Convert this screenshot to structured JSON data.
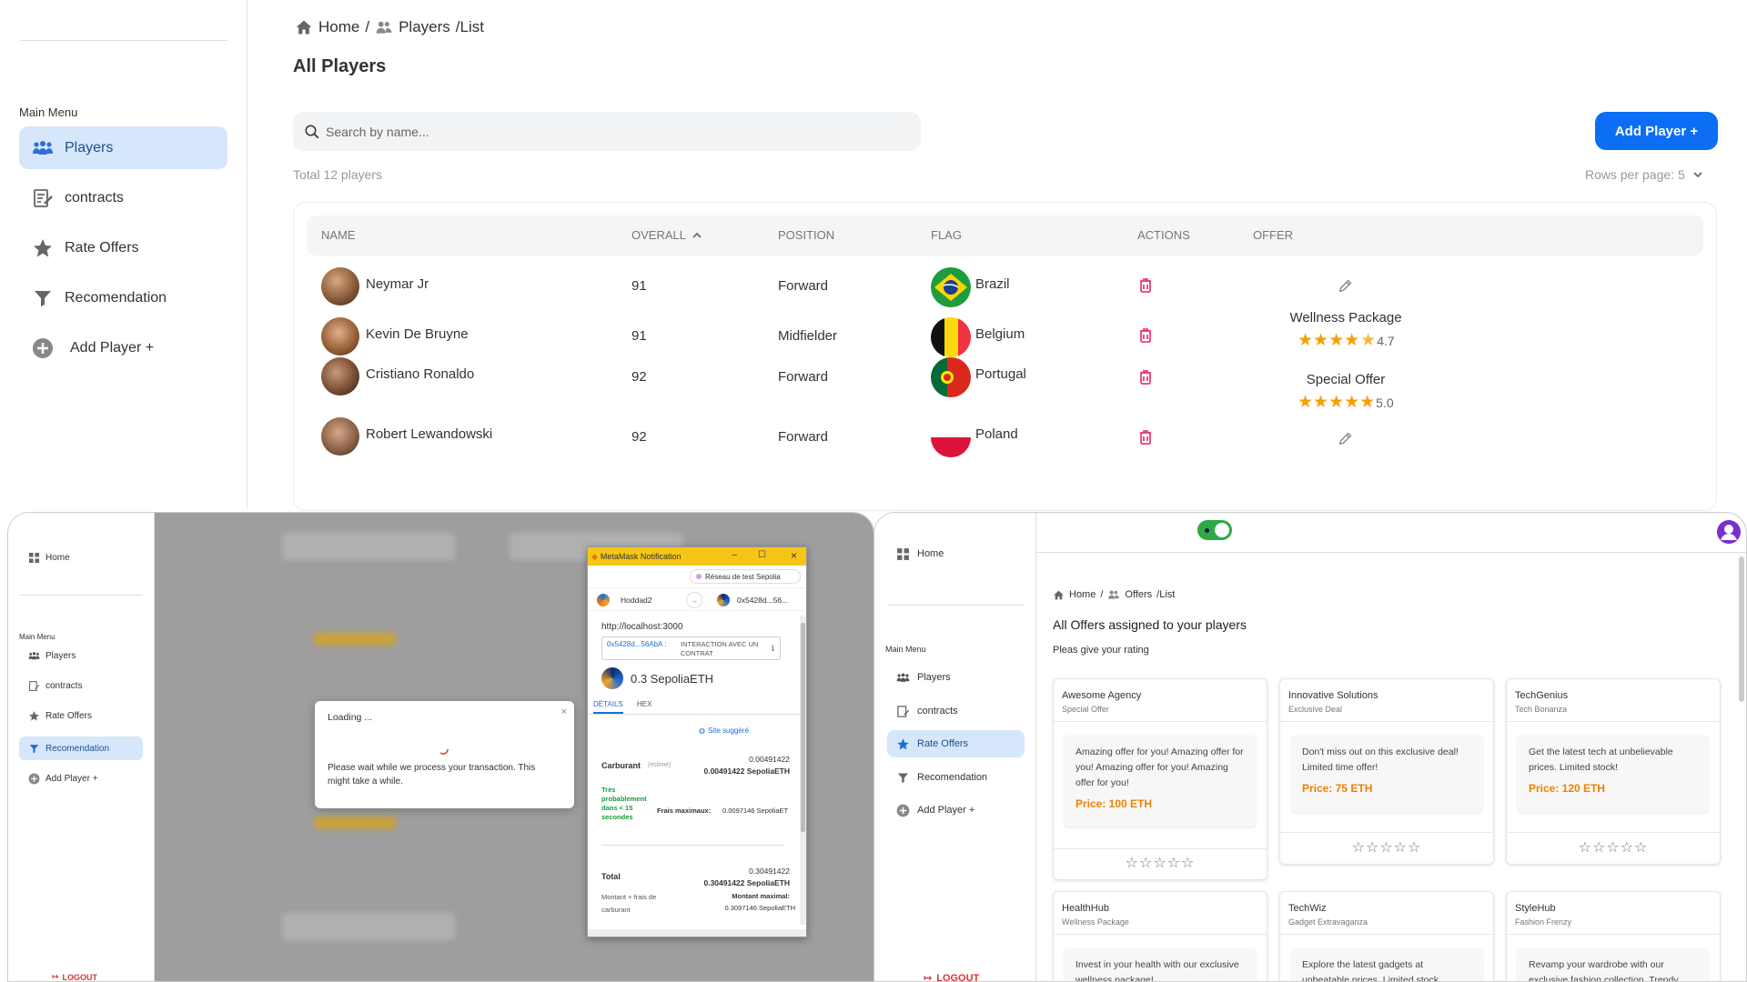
{
  "main": {
    "sidebar": {
      "menu_title": "Main Menu",
      "items": [
        {
          "label": "Players",
          "icon": "players-icon"
        },
        {
          "label": "contracts",
          "icon": "contract-icon"
        },
        {
          "label": "Rate Offers",
          "icon": "star-icon"
        },
        {
          "label": "Recomendation",
          "icon": "filter-icon"
        },
        {
          "label": "Add Player +",
          "icon": "plus-circle-icon"
        }
      ]
    },
    "breadcrumb": {
      "home": "Home",
      "sep1": "/",
      "players": "Players",
      "sep2": "/List"
    },
    "title": "All Players",
    "search_placeholder": "Search by name...",
    "add_button": "Add Player +",
    "total": "Total 12 players",
    "rows_per_page": "Rows per page: 5",
    "columns": [
      "NAME",
      "OVERALL",
      "POSITION",
      "FLAG",
      "ACTIONS",
      "OFFER"
    ],
    "players": [
      {
        "name": "Neymar Jr",
        "overall": "91",
        "position": "Forward",
        "country": "Brazil",
        "offer": "",
        "rating": ""
      },
      {
        "name": "Kevin De Bruyne",
        "overall": "91",
        "position": "Midfielder",
        "country": "Belgium",
        "offer": "Wellness Package",
        "rating": "4.7",
        "stars": 4.5
      },
      {
        "name": "Cristiano Ronaldo",
        "overall": "92",
        "position": "Forward",
        "country": "Portugal",
        "offer": "Special Offer",
        "rating": "5.0",
        "stars": 5
      },
      {
        "name": "Robert Lewandowski",
        "overall": "92",
        "position": "Forward",
        "country": "Poland",
        "offer": "",
        "rating": ""
      }
    ]
  },
  "left_window": {
    "sidebar": {
      "home": "Home",
      "menu_title": "Main Menu",
      "items": [
        "Players",
        "contracts",
        "Rate Offers",
        "Recomendation",
        "Add Player +"
      ],
      "logout": "LOGOUT"
    },
    "loading": {
      "title": "Loading ...",
      "message": "Please wait while we process your transaction. This might take a while."
    },
    "metamask": {
      "title": "MetaMask Notification",
      "network": "Réseau de test Sepolia",
      "from": "Hoddad2",
      "to": "0x5428d...56...",
      "origin": "http://localhost:3000",
      "contract_addr": "0x5428d...56AbA :",
      "contract_label": "INTERACTION AVEC UN CONTRAT",
      "amount": "0.3 SepoliaETH",
      "tabs": [
        "DÉTAILS",
        "HEX"
      ],
      "suggested": "Site suggéré",
      "fuel_label": "Carburant",
      "fuel_est": "(estimé)",
      "fuel_value": "0.00491422",
      "fuel_eth": "0.00491422 SepoliaETH",
      "likely": "Très probablement dans < 15 secondes",
      "max_fee_label": "Frais maximaux:",
      "max_fee": "0.0097146 SepoliaET",
      "total_label": "Total",
      "total_value": "0.30491422",
      "total_eth": "0.30491422 SepoliaETH",
      "amount_fees": "Montant + frais de carburant",
      "max_amount_label": "Montant maximal:",
      "max_amount": "0.3097146 SepoliaETH"
    }
  },
  "right_window": {
    "sidebar": {
      "home": "Home",
      "menu_title": "Main Menu",
      "items": [
        "Players",
        "contracts",
        "Rate Offers",
        "Recomendation",
        "Add Player +"
      ],
      "logout": "LOGOUT"
    },
    "breadcrumb": {
      "home": "Home",
      "sep1": "/",
      "offers": "Offers",
      "sep2": "/List"
    },
    "title": "All Offers assigned to your players",
    "subtitle": "Pleas give your rating",
    "offers": [
      {
        "company": "Awesome Agency",
        "type": "Special Offer",
        "text": "Amazing offer for you! Amazing offer for you! Amazing offer for you! Amazing offer for you!",
        "price": "Price: 100 ETH"
      },
      {
        "company": "Innovative Solutions",
        "type": "Exclusive Deal",
        "text": "Don't miss out on this exclusive deal! Limited time offer!",
        "price": "Price: 75 ETH"
      },
      {
        "company": "TechGenius",
        "type": "Tech Bonanza",
        "text": "Get the latest tech at unbelievable prices. Limited stock!",
        "price": "Price: 120 ETH"
      },
      {
        "company": "HealthHub",
        "type": "Wellness Package",
        "text": "Invest in your health with our exclusive wellness package!",
        "price": ""
      },
      {
        "company": "TechWiz",
        "type": "Gadget Extravaganza",
        "text": "Explore the latest gadgets at unbeatable prices. Limited stock",
        "price": ""
      },
      {
        "company": "StyleHub",
        "type": "Fashion Frenzy",
        "text": "Revamp your wardrobe with our exclusive fashion collection. Trendy",
        "price": ""
      }
    ],
    "empty_stars": "☆☆☆☆☆"
  }
}
